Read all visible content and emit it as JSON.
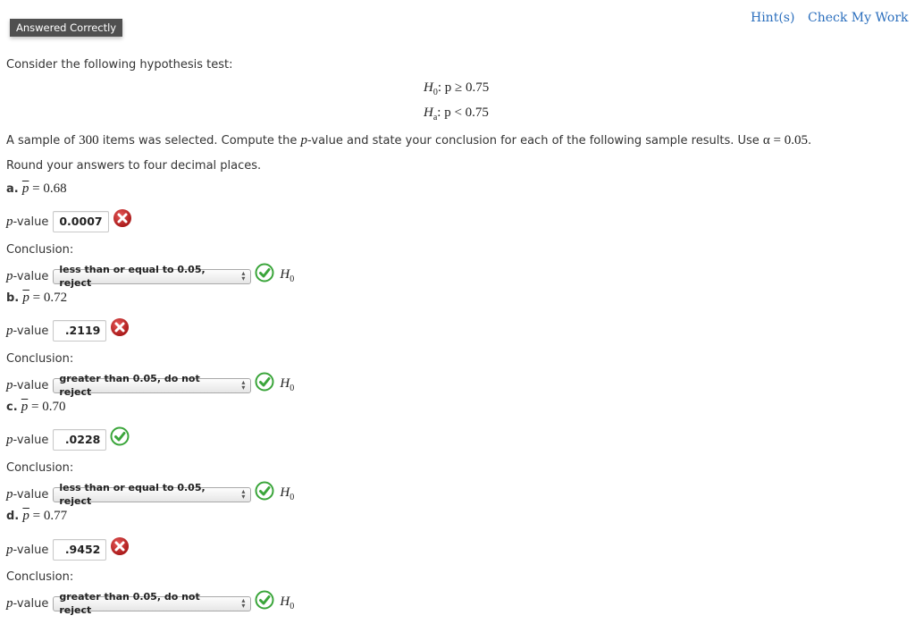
{
  "header": {
    "status_badge": "Answered Correctly",
    "hint_link": "Hint(s)",
    "check_link": "Check My Work"
  },
  "intro": "Consider the following hypothesis test:",
  "hypotheses": {
    "h0_symbol": "H",
    "h0_sub": "0",
    "h0_rel": ": p ≥ 0.75",
    "ha_symbol": "H",
    "ha_sub": "a",
    "ha_rel": ": p < 0.75"
  },
  "instructions": {
    "pre": "A sample of ",
    "n": "300",
    "mid": " items was selected. Compute the ",
    "p": "p",
    "post": "-value and state your conclusion for each of the following sample results. Use ",
    "alpha": "α = 0.05",
    "end": ".",
    "round": "Round your answers to four decimal places."
  },
  "labels": {
    "pvalue_p": "p",
    "pvalue_rest": "-value",
    "conclusion": "Conclusion:",
    "h0_symbol": "H",
    "h0_sub": "0",
    "pbar": "p",
    "equals": " = "
  },
  "parts": [
    {
      "letter": "a.",
      "pbar_value": "0.68",
      "pvalue_input": "0.0007",
      "pvalue_status": "incorrect",
      "conclusion_select": "less than or equal to 0.05, reject",
      "conclusion_status": "correct"
    },
    {
      "letter": "b.",
      "pbar_value": "0.72",
      "pvalue_input": ".2119",
      "pvalue_status": "incorrect",
      "conclusion_select": "greater than 0.05, do not reject",
      "conclusion_status": "correct"
    },
    {
      "letter": "c.",
      "pbar_value": "0.70",
      "pvalue_input": ".0228",
      "pvalue_status": "correct",
      "conclusion_select": "less than or equal to 0.05, reject",
      "conclusion_status": "correct"
    },
    {
      "letter": "d.",
      "pbar_value": "0.77",
      "pvalue_input": ".9452",
      "pvalue_status": "incorrect",
      "conclusion_select": "greater than 0.05, do not reject",
      "conclusion_status": "correct"
    }
  ],
  "colors": {
    "link": "#2a6ebd",
    "badge_bg": "#505050",
    "correct": "#3aa53a",
    "incorrect": "#c62828"
  }
}
